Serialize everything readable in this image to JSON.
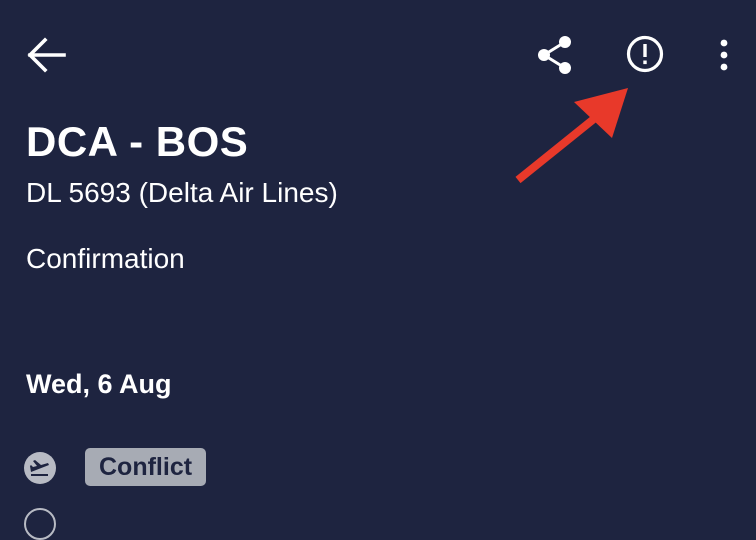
{
  "colors": {
    "background": "#1e2440",
    "text": "#ffffff",
    "badge_bg": "#a7abb4",
    "annotation_arrow": "#e8392a"
  },
  "toolbar": {
    "icons": [
      "back-arrow-icon",
      "share-icon",
      "report-issue-icon",
      "more-vert-icon"
    ]
  },
  "trip": {
    "route": "DCA - BOS",
    "flight": "DL 5693 (Delta Air Lines)",
    "status": "Confirmation",
    "date": "Wed, 6 Aug"
  },
  "conflict": {
    "label": "Conflict",
    "icon": "airplane-icon"
  },
  "annotation": {
    "icon": "red-arrow-pointer"
  }
}
